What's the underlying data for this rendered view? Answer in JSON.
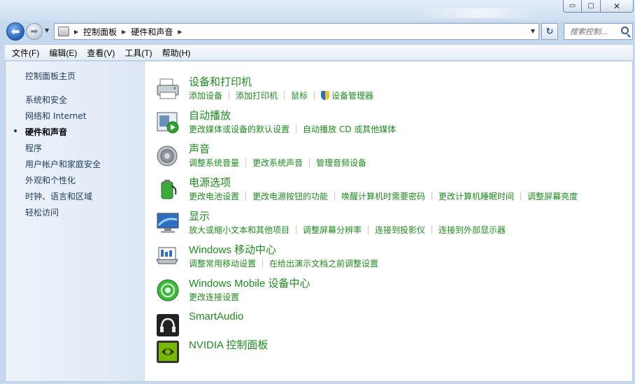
{
  "window": {
    "minimize_glyph": "▭",
    "maximize_glyph": "▢",
    "close_glyph": "✕"
  },
  "nav": {
    "back_glyph": "⬅",
    "forward_glyph": "➡",
    "breadcrumbs": [
      "控制面板",
      "硬件和声音"
    ],
    "refresh_glyph": "↻",
    "search_placeholder": "搜索控制..."
  },
  "menu": [
    "文件(F)",
    "编辑(E)",
    "查看(V)",
    "工具(T)",
    "帮助(H)"
  ],
  "sidebar": {
    "home": "控制面板主页",
    "items": [
      "系统和安全",
      "网络和 Internet",
      "硬件和声音",
      "程序",
      "用户帐户和家庭安全",
      "外观和个性化",
      "时钟、语言和区域",
      "轻松访问"
    ],
    "current_index": 2
  },
  "categories": [
    {
      "title": "设备和打印机",
      "icon": "printer-icon",
      "links": [
        "添加设备",
        "添加打印机",
        "鼠标",
        "设备管理器"
      ]
    },
    {
      "title": "自动播放",
      "icon": "autoplay-icon",
      "links": [
        "更改媒体或设备的默认设置",
        "自动播放 CD 或其他媒体"
      ]
    },
    {
      "title": "声音",
      "icon": "speaker-icon",
      "links": [
        "调整系统音量",
        "更改系统声音",
        "管理音频设备"
      ]
    },
    {
      "title": "电源选项",
      "icon": "power-icon",
      "links": [
        "更改电池设置",
        "更改电源按钮的功能",
        "唤醒计算机时需要密码",
        "更改计算机睡眠时间",
        "调整屏幕亮度"
      ]
    },
    {
      "title": "显示",
      "icon": "display-icon",
      "links": [
        "放大或缩小文本和其他项目",
        "调整屏幕分辨率",
        "连接到投影仪",
        "连接到外部显示器"
      ]
    },
    {
      "title": "Windows 移动中心",
      "icon": "mobility-center-icon",
      "links": [
        "调整常用移动设置",
        "在给出演示文档之前调整设置"
      ]
    },
    {
      "title": "Windows Mobile 设备中心",
      "icon": "mobile-device-center-icon",
      "links": [
        "更改连接设置"
      ]
    },
    {
      "title": "SmartAudio",
      "icon": "headphones-icon",
      "links": []
    },
    {
      "title": "NVIDIA 控制面板",
      "icon": "nvidia-icon",
      "links": []
    }
  ]
}
